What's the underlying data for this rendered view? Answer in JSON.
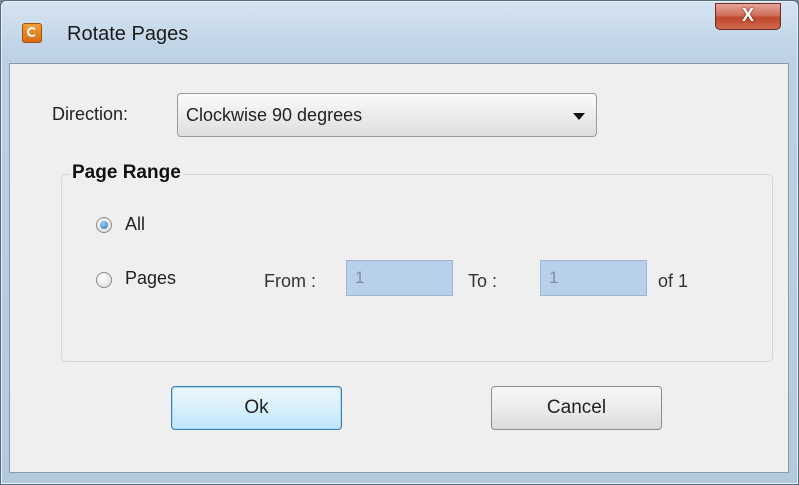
{
  "window": {
    "title": "Rotate Pages",
    "close_label": "X",
    "app_icon": "app-logo-icon"
  },
  "direction": {
    "label": "Direction:",
    "selected": "Clockwise 90 degrees"
  },
  "page_range": {
    "title": "Page Range",
    "all_label": "All",
    "pages_label": "Pages",
    "selected_option": "All",
    "from_label": "From :",
    "from_value": "1",
    "to_label": "To :",
    "to_value": "1",
    "of_label": "of 1"
  },
  "buttons": {
    "ok": "Ok",
    "cancel": "Cancel"
  },
  "colors": {
    "close_button": "#c0452c",
    "disabled_input": "#b8d0ec",
    "default_button_border": "#3c7fb1"
  }
}
